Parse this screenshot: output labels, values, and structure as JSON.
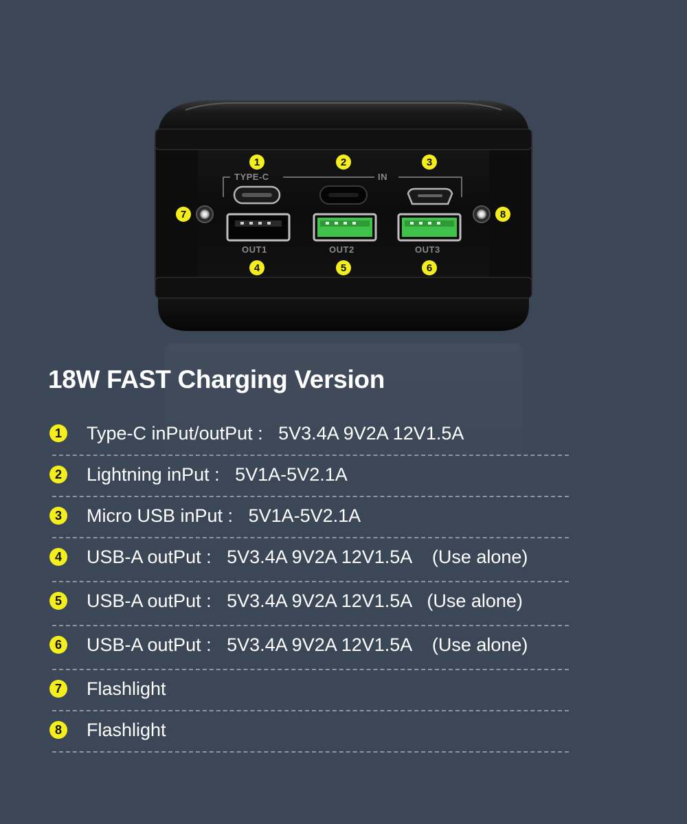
{
  "device": {
    "markers": [
      "1",
      "2",
      "3",
      "4",
      "5",
      "6",
      "7",
      "8"
    ],
    "port_labels": {
      "typec": "TYPE-C",
      "in": "IN",
      "out1": "OUT1",
      "out2": "OUT2",
      "out3": "OUT3"
    }
  },
  "heading": "18W FAST Charging Version",
  "specs": [
    {
      "num": "1",
      "text": "Type-C inPut/outPut :   5V3.4A 9V2A 12V1.5A"
    },
    {
      "num": "2",
      "text": "Lightning inPut :   5V1A-5V2.1A"
    },
    {
      "num": "3",
      "text": "Micro USB inPut :   5V1A-5V2.1A"
    },
    {
      "num": "4",
      "text": "USB-A outPut :   5V3.4A 9V2A 12V1.5A    (Use alone)"
    },
    {
      "num": "5",
      "text": "USB-A outPut :   5V3.4A 9V2A 12V1.5A   (Use alone)"
    },
    {
      "num": "6",
      "text": "USB-A outPut :   5V3.4A 9V2A 12V1.5A    (Use alone)"
    },
    {
      "num": "7",
      "text": "Flashlight"
    },
    {
      "num": "8",
      "text": "Flashlight"
    }
  ],
  "colors": {
    "background": "#3b4656",
    "marker": "#f4ee1c",
    "port_green": "#3fc14a",
    "divider": "#8b95a3"
  }
}
